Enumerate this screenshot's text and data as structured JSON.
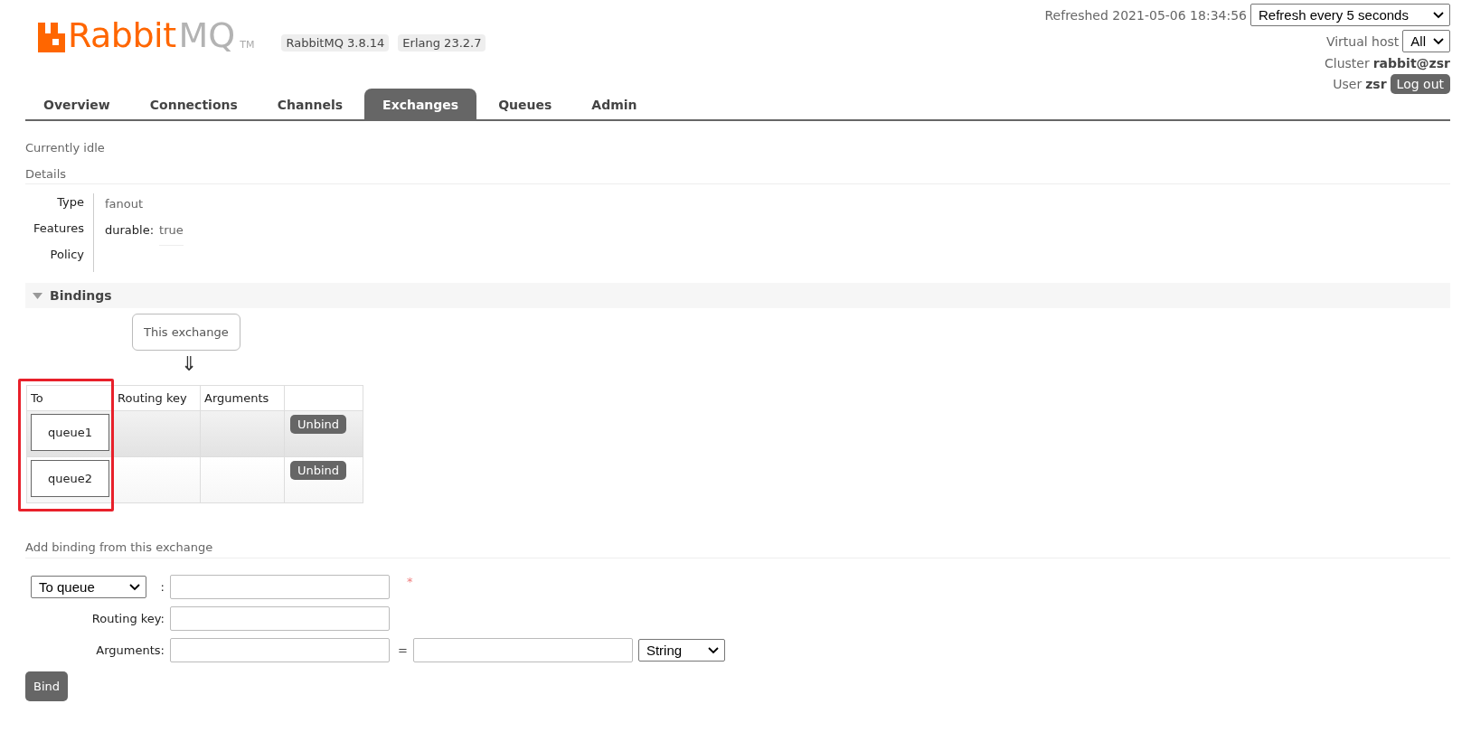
{
  "header": {
    "logo": {
      "brand": "Rabbit",
      "suffix": "MQ",
      "mark": "TM"
    },
    "versions": [
      "RabbitMQ 3.8.14",
      "Erlang 23.2.7"
    ],
    "refreshed": "Refreshed 2021-05-06 18:34:56",
    "refresh_select": "Refresh every 5 seconds",
    "virtual_host_label": "Virtual host",
    "virtual_host": "All",
    "cluster_label": "Cluster",
    "cluster": "rabbit@zsr",
    "user_label": "User",
    "user": "zsr",
    "logout": "Log out"
  },
  "tabs": [
    {
      "label": "Overview",
      "selected": false
    },
    {
      "label": "Connections",
      "selected": false
    },
    {
      "label": "Channels",
      "selected": false
    },
    {
      "label": "Exchanges",
      "selected": true
    },
    {
      "label": "Queues",
      "selected": false
    },
    {
      "label": "Admin",
      "selected": false
    }
  ],
  "status": "Currently idle",
  "details": {
    "title": "Details",
    "rows": [
      {
        "label": "Type",
        "value": "fanout"
      },
      {
        "label": "Features",
        "key": "durable:",
        "value": "true"
      },
      {
        "label": "Policy"
      }
    ]
  },
  "bindings": {
    "title": "Bindings",
    "expanded": true,
    "source": "This exchange",
    "arrow": "⇓",
    "table": {
      "columns": [
        {
          "label": "To",
          "highlighted": true
        },
        {
          "label": "Routing key",
          "highlighted": false
        },
        {
          "label": "Arguments",
          "highlighted": false
        }
      ],
      "rows": [
        {
          "to": "queue1",
          "action": "Unbind"
        },
        {
          "to": "queue2",
          "action": "Unbind"
        }
      ]
    }
  },
  "add_binding": {
    "title": "Add binding from this exchange",
    "target_select": "To queue",
    "colon": ":",
    "required": "*",
    "routing_key_label": "Routing key:",
    "arguments_label": "Arguments:",
    "equals": "=",
    "type_select": "String",
    "submit": "Bind"
  }
}
